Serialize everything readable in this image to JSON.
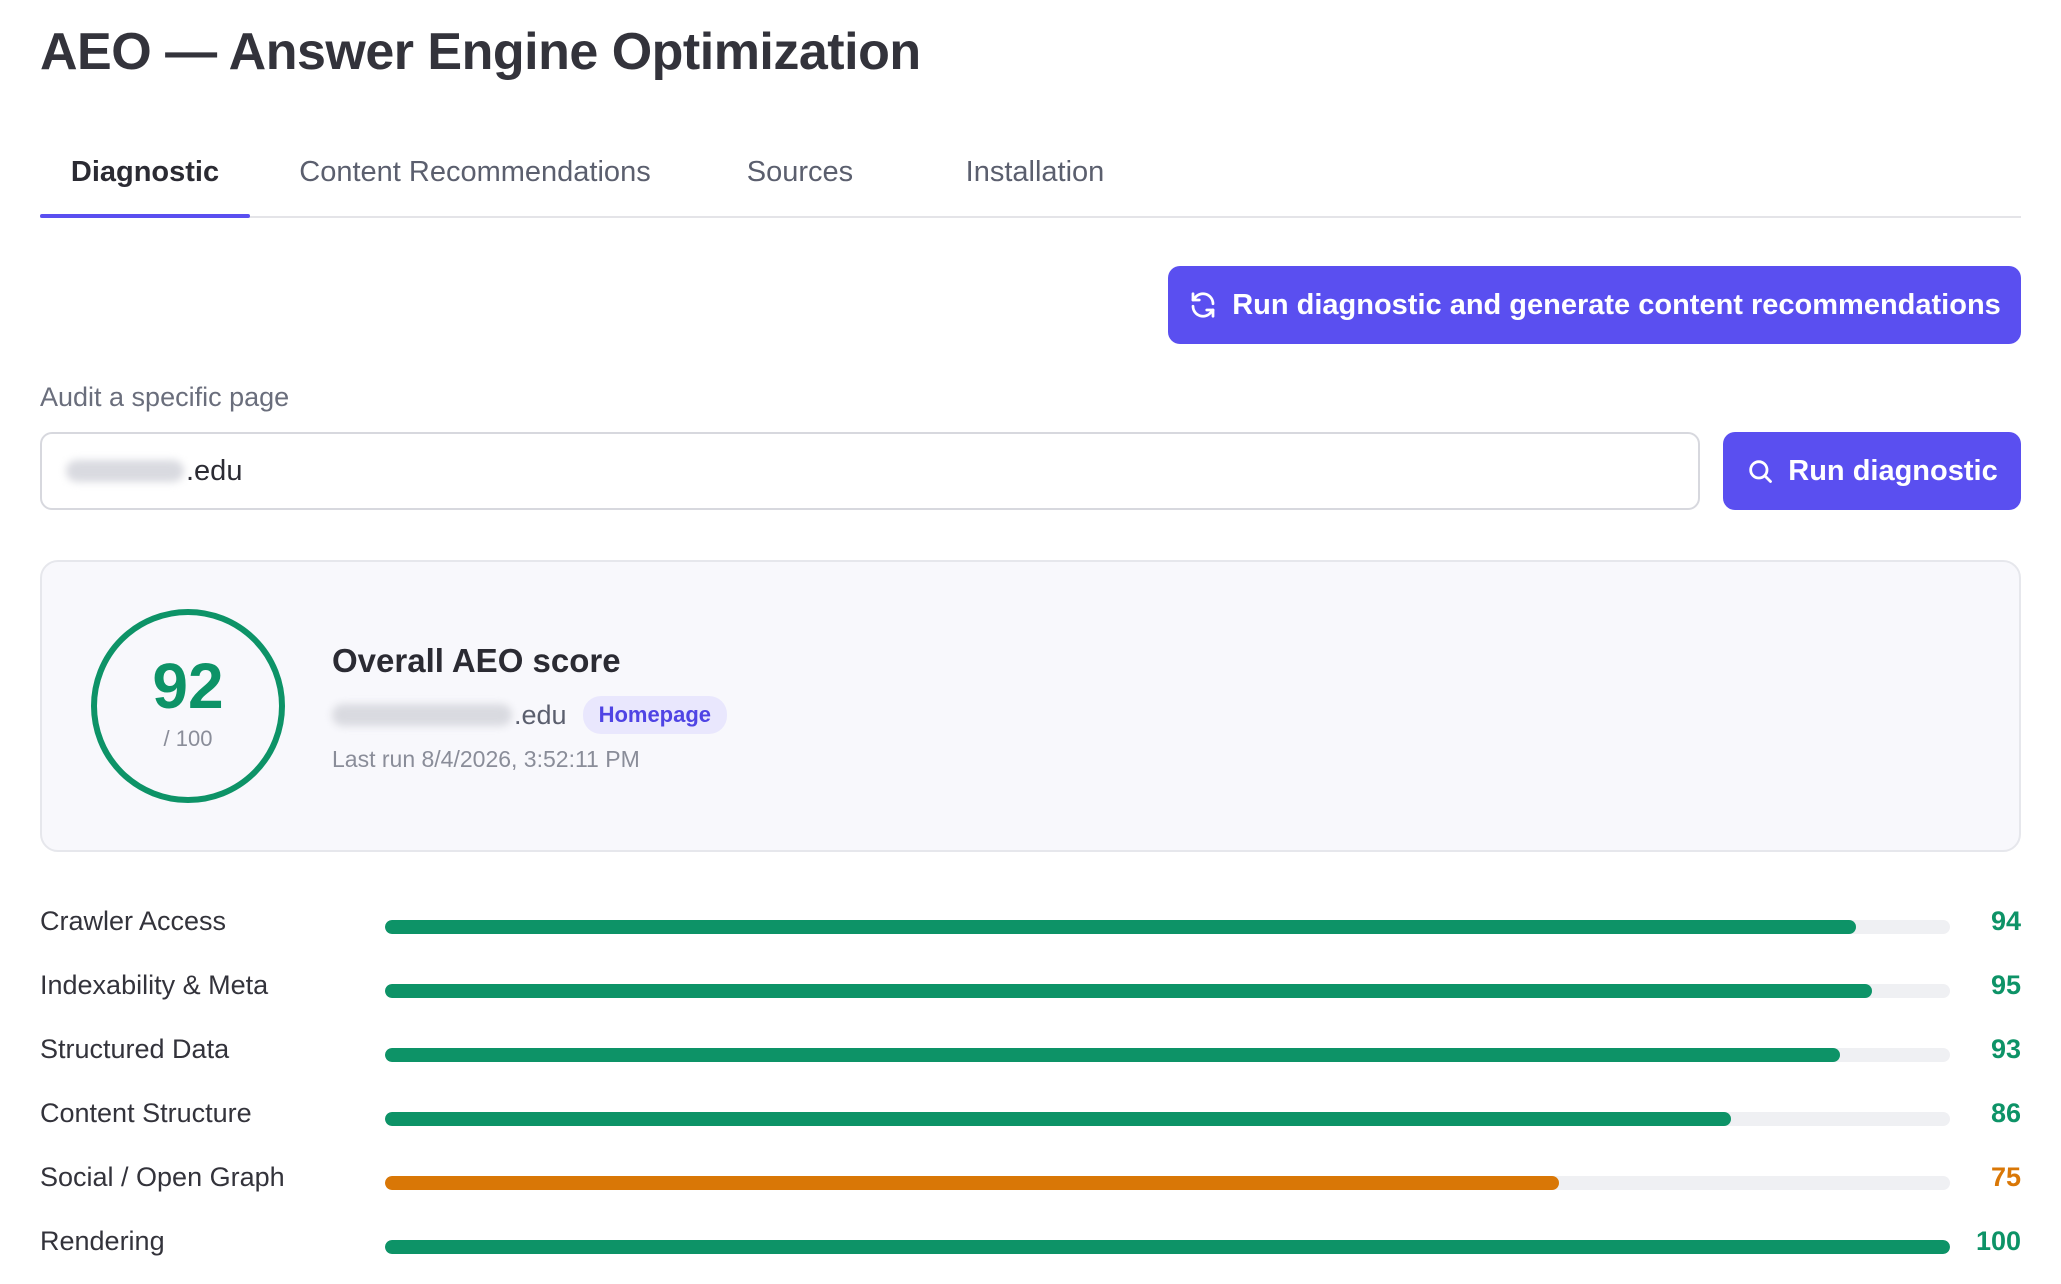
{
  "header": {
    "title": "AEO — Answer Engine Optimization"
  },
  "tabs": [
    {
      "label": "Diagnostic",
      "active": true
    },
    {
      "label": "Content Recommendations",
      "active": false
    },
    {
      "label": "Sources",
      "active": false
    },
    {
      "label": "Installation",
      "active": false
    }
  ],
  "actions": {
    "generate_label": "Run diagnostic and generate content recommendations",
    "generate_icon": "refresh-icon",
    "run_label": "Run diagnostic",
    "run_icon": "search-icon"
  },
  "audit": {
    "label": "Audit a specific page",
    "input_value_visible": ".edu"
  },
  "score": {
    "value": "92",
    "max": "/ 100",
    "title": "Overall AEO score",
    "url_visible": ".edu",
    "badge": "Homepage",
    "last_run": "Last run 8/4/2026, 3:52:11 PM"
  },
  "metrics": [
    {
      "label": "Crawler Access",
      "value": 94,
      "value_text": "94",
      "color": "#0d9367"
    },
    {
      "label": "Indexability & Meta",
      "value": 95,
      "value_text": "95",
      "color": "#0d9367"
    },
    {
      "label": "Structured Data",
      "value": 93,
      "value_text": "93",
      "color": "#0d9367"
    },
    {
      "label": "Content Structure",
      "value": 86,
      "value_text": "86",
      "color": "#0d9367"
    },
    {
      "label": "Social / Open Graph",
      "value": 75,
      "value_text": "75",
      "color": "#d97706"
    },
    {
      "label": "Rendering",
      "value": 100,
      "value_text": "100",
      "color": "#0d9367"
    }
  ],
  "colors": {
    "accent": "#5a4ff0",
    "good": "#0d9367",
    "warning": "#d97706"
  }
}
